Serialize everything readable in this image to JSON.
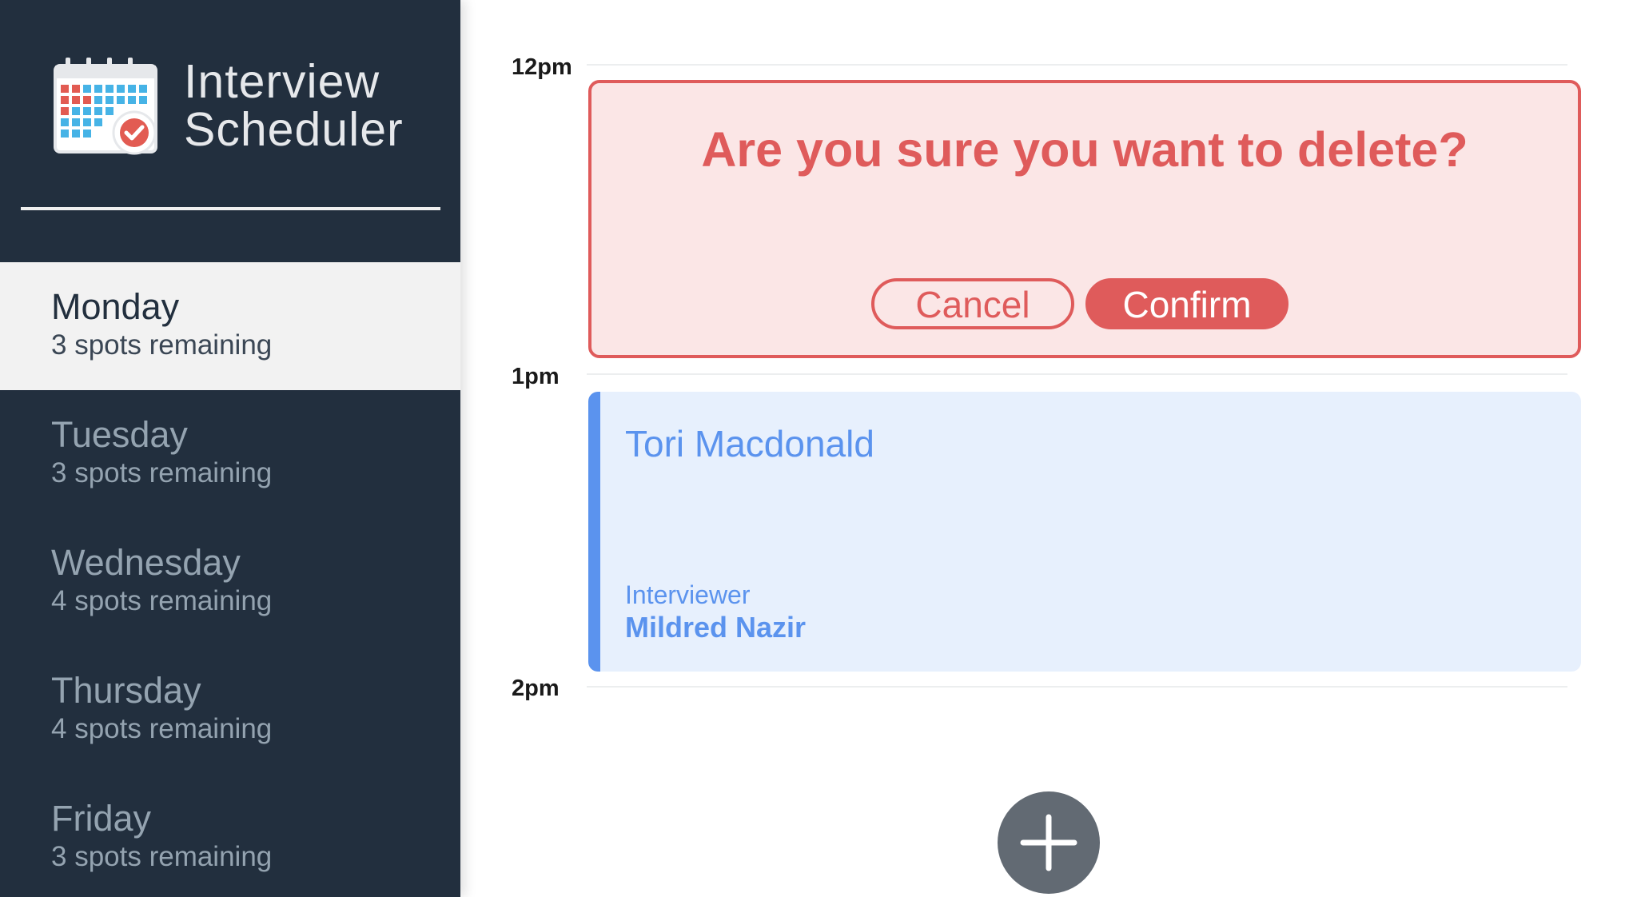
{
  "sidebar": {
    "brand": {
      "line1": "Interview",
      "line2": "Scheduler"
    },
    "days": [
      {
        "name": "Monday",
        "spots": "3 spots remaining",
        "selected": true
      },
      {
        "name": "Tuesday",
        "spots": "3 spots remaining",
        "selected": false
      },
      {
        "name": "Wednesday",
        "spots": "4 spots remaining",
        "selected": false
      },
      {
        "name": "Thursday",
        "spots": "4 spots remaining",
        "selected": false
      },
      {
        "name": "Friday",
        "spots": "3 spots remaining",
        "selected": false
      }
    ]
  },
  "schedule": {
    "times": [
      "12pm",
      "1pm",
      "2pm"
    ],
    "confirm": {
      "message": "Are you sure you want to delete?",
      "cancel_label": "Cancel",
      "confirm_label": "Confirm"
    },
    "appointment": {
      "student": "Tori Macdonald",
      "interviewer_label": "Interviewer",
      "interviewer_name": "Mildred Nazir"
    },
    "add_icon": "plus-icon"
  },
  "colors": {
    "sidebar_bg": "#222f3e",
    "danger": "#df5b5b",
    "danger_bg": "#fbe6e6",
    "accent": "#5b93ee",
    "accent_bg": "#e7f0fd"
  }
}
